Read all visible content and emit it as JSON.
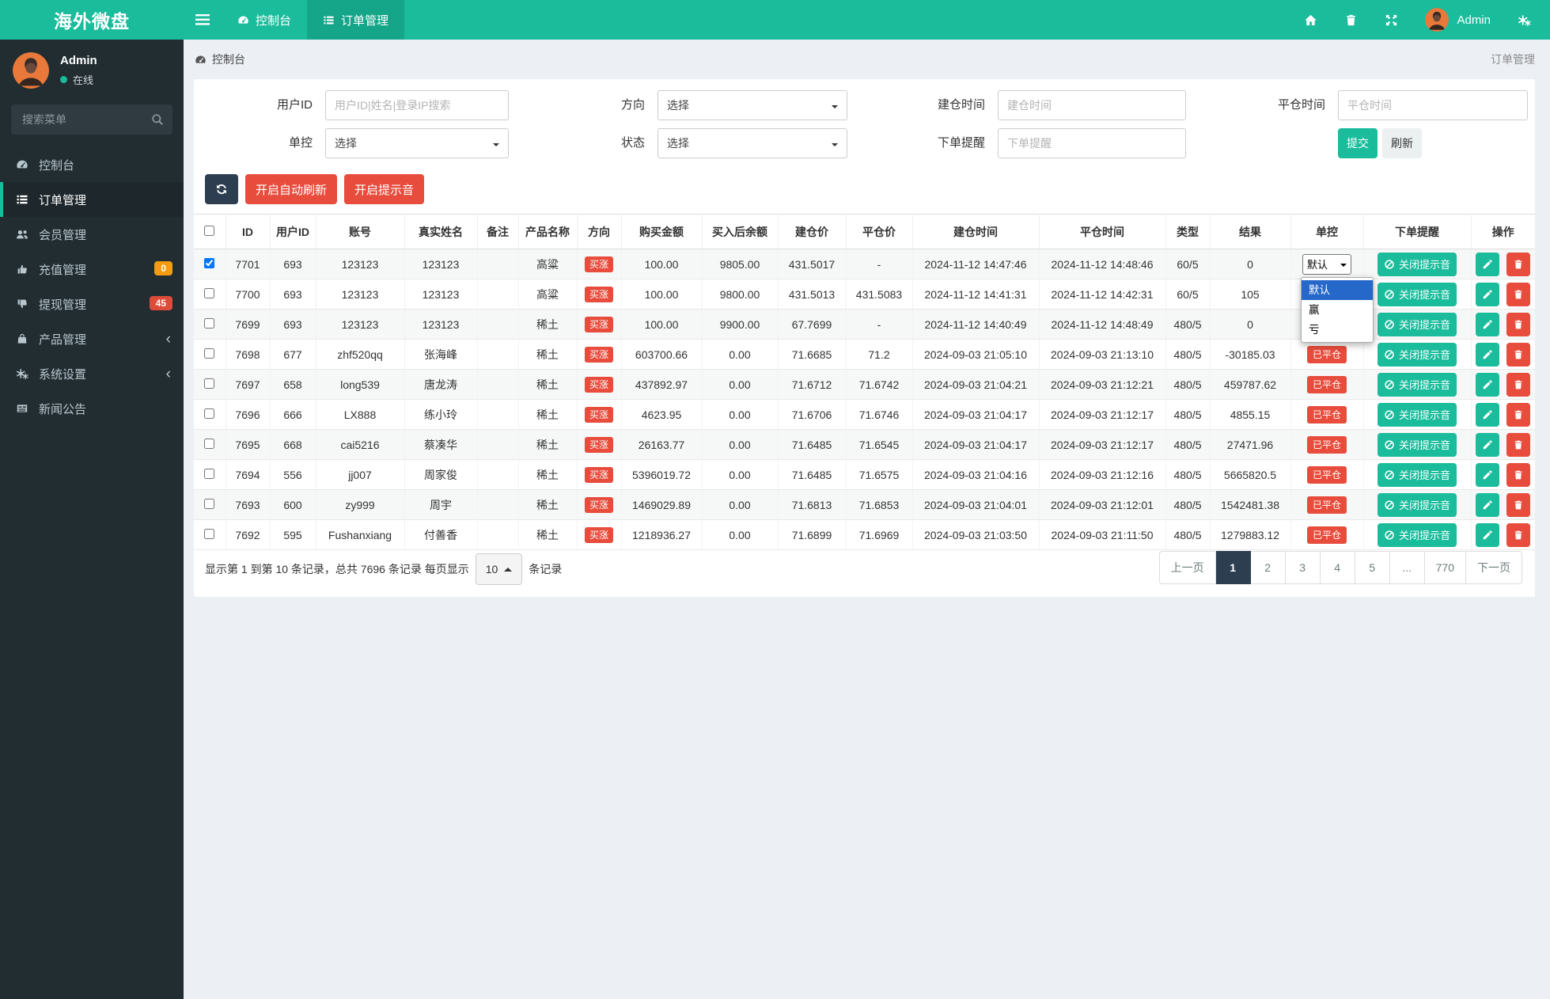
{
  "colors": {
    "accent": "#1abc9c",
    "accent_dark": "#15a589",
    "danger": "#e74c3c",
    "dark": "#2c3e50",
    "warning": "#f39c12",
    "sidebar_bg": "#222d32",
    "content_bg": "#ecf0f5",
    "select_highlight": "#2668c9"
  },
  "navbar": {
    "brand": "海外微盘",
    "tabs": [
      {
        "label": "控制台",
        "icon": "dashboard-icon",
        "active": false
      },
      {
        "label": "订单管理",
        "icon": "list-icon",
        "active": true
      }
    ],
    "icons": [
      "home-icon",
      "trash-icon",
      "expand-icon",
      "user-avatar",
      "gears-icon"
    ],
    "user_name": "Admin"
  },
  "sidebar": {
    "user": {
      "name": "Admin",
      "status": "在线"
    },
    "search_placeholder": "搜索菜单",
    "items": [
      {
        "label": "控制台",
        "icon": "dashboard-icon"
      },
      {
        "label": "订单管理",
        "icon": "list-icon",
        "active": true
      },
      {
        "label": "会员管理",
        "icon": "users-icon"
      },
      {
        "label": "充值管理",
        "icon": "hand-up-icon",
        "badge": "0",
        "badge_color": "#f39c12"
      },
      {
        "label": "提现管理",
        "icon": "hand-down-icon",
        "badge": "45",
        "badge_color": "#dd4b39"
      },
      {
        "label": "产品管理",
        "icon": "bag-icon",
        "chevron": "‹"
      },
      {
        "label": "系统设置",
        "icon": "gears-icon",
        "chevron": "‹"
      },
      {
        "label": "新闻公告",
        "icon": "news-icon"
      }
    ]
  },
  "breadcrumb": {
    "location": "控制台",
    "page": "订单管理"
  },
  "filters": {
    "user_id": {
      "label": "用户ID",
      "placeholder": "用户ID|姓名|登录IP搜索"
    },
    "direction": {
      "label": "方向",
      "value": "选择"
    },
    "open_time": {
      "label": "建仓时间",
      "placeholder": "建仓时间"
    },
    "close_time": {
      "label": "平仓时间",
      "placeholder": "平仓时间"
    },
    "control": {
      "label": "单控",
      "value": "选择"
    },
    "status": {
      "label": "状态",
      "value": "选择"
    },
    "order_notice": {
      "label": "下单提醒",
      "placeholder": "下单提醒"
    },
    "submit": "提交",
    "refresh": "刷新"
  },
  "toolbar": {
    "auto_refresh": "开启自动刷新",
    "sound": "开启提示音"
  },
  "table": {
    "headers": [
      "ID",
      "用户ID",
      "账号",
      "真实姓名",
      "备注",
      "产品名称",
      "方向",
      "购买金额",
      "买入后余额",
      "建仓价",
      "平仓价",
      "建仓时间",
      "平仓时间",
      "类型",
      "结果",
      "单控",
      "下单提醒",
      "操作"
    ],
    "direction_label": "买涨",
    "closed_label": "已平仓",
    "mute_label": "关闭提示音",
    "rows": [
      {
        "id": "7701",
        "uid": "693",
        "account": "123123",
        "name": "123123",
        "note": "",
        "product": "高粱",
        "amount": "100.00",
        "balance": "9805.00",
        "open_price": "431.5017",
        "close_price": "-",
        "open_time": "2024-11-12 14:47:46",
        "close_time": "2024-11-12 14:48:46",
        "type": "60/5",
        "result": "0",
        "control": "select",
        "checked": true
      },
      {
        "id": "7700",
        "uid": "693",
        "account": "123123",
        "name": "123123",
        "note": "",
        "product": "高粱",
        "amount": "100.00",
        "balance": "9800.00",
        "open_price": "431.5013",
        "close_price": "431.5083",
        "open_time": "2024-11-12 14:41:31",
        "close_time": "2024-11-12 14:42:31",
        "type": "60/5",
        "result": "105",
        "control": "covered",
        "checked": false
      },
      {
        "id": "7699",
        "uid": "693",
        "account": "123123",
        "name": "123123",
        "note": "",
        "product": "稀土",
        "amount": "100.00",
        "balance": "9900.00",
        "open_price": "67.7699",
        "close_price": "-",
        "open_time": "2024-11-12 14:40:49",
        "close_time": "2024-11-12 14:48:49",
        "type": "480/5",
        "result": "0",
        "control": "covered",
        "checked": false
      },
      {
        "id": "7698",
        "uid": "677",
        "account": "zhf520qq",
        "name": "张海峰",
        "note": "",
        "product": "稀土",
        "amount": "603700.66",
        "balance": "0.00",
        "open_price": "71.6685",
        "close_price": "71.2",
        "open_time": "2024-09-03 21:05:10",
        "close_time": "2024-09-03 21:13:10",
        "type": "480/5",
        "result": "-30185.03",
        "control": "closed",
        "checked": false
      },
      {
        "id": "7697",
        "uid": "658",
        "account": "long539",
        "name": "唐龙涛",
        "note": "",
        "product": "稀土",
        "amount": "437892.97",
        "balance": "0.00",
        "open_price": "71.6712",
        "close_price": "71.6742",
        "open_time": "2024-09-03 21:04:21",
        "close_time": "2024-09-03 21:12:21",
        "type": "480/5",
        "result": "459787.62",
        "control": "closed",
        "checked": false
      },
      {
        "id": "7696",
        "uid": "666",
        "account": "LX888",
        "name": "练小玲",
        "note": "",
        "product": "稀土",
        "amount": "4623.95",
        "balance": "0.00",
        "open_price": "71.6706",
        "close_price": "71.6746",
        "open_time": "2024-09-03 21:04:17",
        "close_time": "2024-09-03 21:12:17",
        "type": "480/5",
        "result": "4855.15",
        "control": "closed",
        "checked": false
      },
      {
        "id": "7695",
        "uid": "668",
        "account": "cai5216",
        "name": "蔡凑华",
        "note": "",
        "product": "稀土",
        "amount": "26163.77",
        "balance": "0.00",
        "open_price": "71.6485",
        "close_price": "71.6545",
        "open_time": "2024-09-03 21:04:17",
        "close_time": "2024-09-03 21:12:17",
        "type": "480/5",
        "result": "27471.96",
        "control": "closed",
        "checked": false
      },
      {
        "id": "7694",
        "uid": "556",
        "account": "jj007",
        "name": "周家俊",
        "note": "",
        "product": "稀土",
        "amount": "5396019.72",
        "balance": "0.00",
        "open_price": "71.6485",
        "close_price": "71.6575",
        "open_time": "2024-09-03 21:04:16",
        "close_time": "2024-09-03 21:12:16",
        "type": "480/5",
        "result": "5665820.5",
        "control": "closed",
        "checked": false
      },
      {
        "id": "7693",
        "uid": "600",
        "account": "zy999",
        "name": "周宇",
        "note": "",
        "product": "稀土",
        "amount": "1469029.89",
        "balance": "0.00",
        "open_price": "71.6813",
        "close_price": "71.6853",
        "open_time": "2024-09-03 21:04:01",
        "close_time": "2024-09-03 21:12:01",
        "type": "480/5",
        "result": "1542481.38",
        "control": "closed",
        "checked": false
      },
      {
        "id": "7692",
        "uid": "595",
        "account": "Fushanxiang",
        "name": "付善香",
        "note": "",
        "product": "稀土",
        "amount": "1218936.27",
        "balance": "0.00",
        "open_price": "71.6899",
        "close_price": "71.6969",
        "open_time": "2024-09-03 21:03:50",
        "close_time": "2024-09-03 21:11:50",
        "type": "480/5",
        "result": "1279883.12",
        "control": "closed",
        "checked": false
      }
    ]
  },
  "order_control": {
    "value": "默认",
    "options": [
      "默认",
      "赢",
      "亏"
    ]
  },
  "pagination": {
    "info_prefix": "显示第 1 到第 10 条记录，总共 7696 条记录 每页显示",
    "per_page": "10",
    "info_suffix": "条记录",
    "pages": [
      "上一页",
      "1",
      "2",
      "3",
      "4",
      "5",
      "...",
      "770",
      "下一页"
    ],
    "active": "1"
  }
}
